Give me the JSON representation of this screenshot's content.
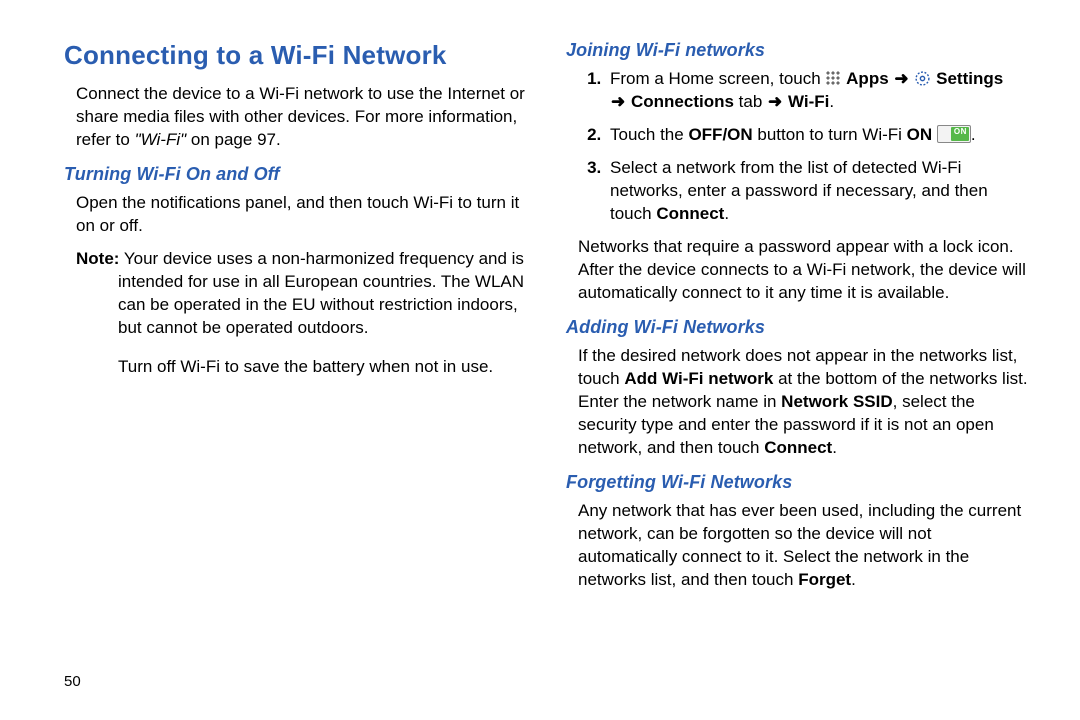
{
  "page_number": "50",
  "title": "Connecting to a Wi-Fi Network",
  "left": {
    "intro": "Connect the device to a Wi-Fi network to use the Internet or share media files with other devices. For more information, refer to ",
    "intro_ref_italic": "\"Wi-Fi\"",
    "intro_tail": " on page 97.",
    "sub1": "Turning Wi-Fi On and Off",
    "sub1_body": "Open the notifications panel, and then touch Wi-Fi to turn it on or off.",
    "note_label": "Note:",
    "note_body1": " Your device uses a non-harmonized frequency and is intended for use in all European countries. The WLAN can be operated in the EU without restriction indoors, but cannot be operated outdoors.",
    "note_body2": "Turn off Wi-Fi to save the battery when not in use."
  },
  "right": {
    "sub1": "Joining Wi-Fi networks",
    "steps": {
      "s1_a": "From a Home screen, touch ",
      "s1_apps": "Apps",
      "s1_arrow": "➜",
      "s1_settings": "Settings",
      "s1_conn": "Connections",
      "s1_tab": " tab ",
      "s1_wifi": "Wi-Fi",
      "s1_period": ".",
      "s2_a": "Touch the ",
      "s2_offon": "OFF/ON",
      "s2_b": " button to turn Wi-Fi ",
      "s2_on": "ON",
      "s2_end": " .",
      "on_label": "ON",
      "s3_a": "Select a network from the list of detected Wi-Fi networks, enter a password if necessary, and then touch ",
      "s3_connect": "Connect",
      "s3_period": "."
    },
    "para_after_steps": "Networks that require a password appear with a lock icon. After the device connects to a Wi-Fi network, the device will automatically connect to it any time it is available.",
    "sub2": "Adding Wi-Fi Networks",
    "sub2_body_a": "If the desired network does not appear in the networks list, touch ",
    "sub2_addwifi": "Add Wi-Fi network",
    "sub2_body_b": " at the bottom of the networks list. Enter the network name in ",
    "sub2_ssid": "Network SSID",
    "sub2_body_c": ", select the security type and enter the password if it is not an open network, and then touch ",
    "sub2_connect": "Connect",
    "sub2_period": ".",
    "sub3": "Forgetting Wi-Fi Networks",
    "sub3_body_a": "Any network that has ever been used, including the current network, can be forgotten so the device will not automatically connect to it. Select the network in the networks list, and then touch ",
    "sub3_forget": "Forget",
    "sub3_period": "."
  }
}
